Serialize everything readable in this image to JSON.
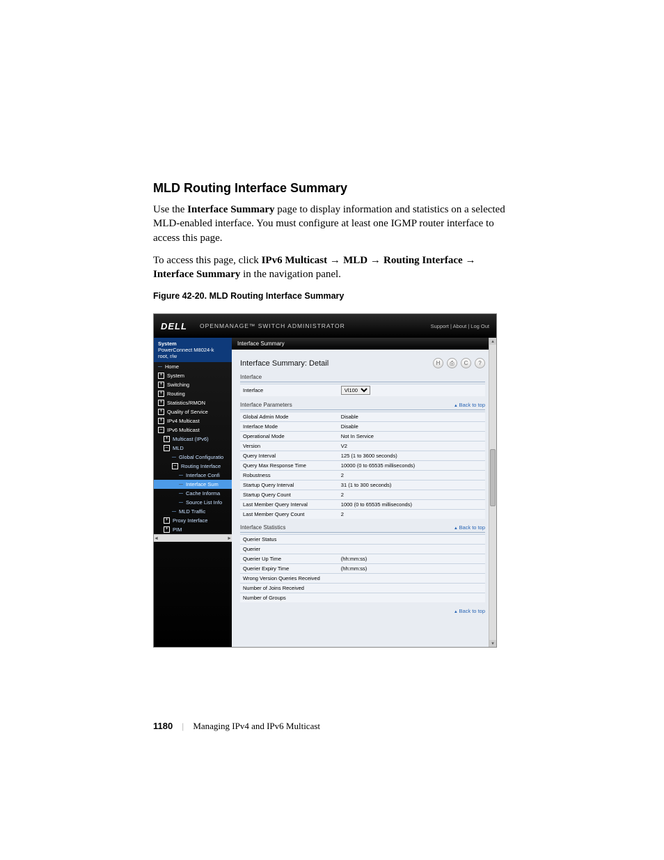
{
  "doc": {
    "heading": "MLD Routing Interface Summary",
    "para1_a": "Use the ",
    "para1_b": "Interface Summary",
    "para1_c": " page to display information and statistics on a selected MLD-enabled interface. You must configure at least one IGMP router interface to access this page.",
    "para2_a": "To access this page, click ",
    "para2_b": "IPv6 Multicast",
    "para2_c": "MLD",
    "para2_d": "Routing Interface",
    "para2_e": "Interface Summary",
    "para2_f": " in the navigation panel.",
    "figcap": "Figure 42-20.    MLD Routing Interface Summary"
  },
  "app": {
    "brand": "DELL",
    "brandsub": "OPENMANAGE™ SWITCH ADMINISTRATOR",
    "toplinks": "Support  |  About  |  Log Out",
    "crumb": "Interface Summary",
    "system_label": "System",
    "system_model": "PowerConnect M8024-k",
    "system_user": "root, r/w"
  },
  "nav": {
    "home": "Home",
    "system": "System",
    "switching": "Switching",
    "routing": "Routing",
    "stats": "Statistics/RMON",
    "qos": "Quality of Service",
    "ipv4m": "IPv4 Multicast",
    "ipv6m": "IPv6 Multicast",
    "mldipv6": "Multicast (IPv6)",
    "mld": "MLD",
    "globalcfg": "Global Configuratio",
    "routif": "Routing Interface",
    "ifconf": "Interface Confi",
    "ifsum": "Interface Sum",
    "cacheinfo": "Cache Informa",
    "srclist": "Source List Info",
    "mldtraf": "MLD Traffic",
    "proxyif": "Proxy Interface",
    "pim": "PIM"
  },
  "detail": {
    "title": "Interface Summary: Detail",
    "sect_interface": "Interface",
    "interface_label": "Interface",
    "interface_value": "Vl100",
    "sect_params": "Interface Parameters",
    "back": "Back to top",
    "rows_params": [
      {
        "k": "Global Admin Mode",
        "v": "Disable"
      },
      {
        "k": "Interface Mode",
        "v": "Disable"
      },
      {
        "k": "Operational Mode",
        "v": "Not In Service"
      },
      {
        "k": "Version",
        "v": "V2"
      },
      {
        "k": "Query Interval",
        "v": "125  (1 to 3600 seconds)"
      },
      {
        "k": "Query Max Response Time",
        "v": "10000  (0 to 65535 milliseconds)"
      },
      {
        "k": "Robustness",
        "v": "2"
      },
      {
        "k": "Startup Query Interval",
        "v": "31  (1 to 300 seconds)"
      },
      {
        "k": "Startup Query Count",
        "v": "2"
      },
      {
        "k": "Last Member Query Interval",
        "v": "1000  (0 to 65535 milliseconds)"
      },
      {
        "k": "Last Member Query Count",
        "v": "2"
      }
    ],
    "sect_stats": "Interface Statistics",
    "rows_stats": [
      {
        "k": "Querier Status",
        "v": ""
      },
      {
        "k": "Querier",
        "v": ""
      },
      {
        "k": "Querier Up Time",
        "v": "(hh:mm:ss)"
      },
      {
        "k": "Querier Expiry Time",
        "v": "(hh:mm:ss)"
      },
      {
        "k": "Wrong Version Queries Received",
        "v": ""
      },
      {
        "k": "Number of Joins Received",
        "v": ""
      },
      {
        "k": "Number of Groups",
        "v": ""
      }
    ]
  },
  "footer": {
    "page": "1180",
    "chapter": "Managing IPv4 and IPv6 Multicast"
  }
}
